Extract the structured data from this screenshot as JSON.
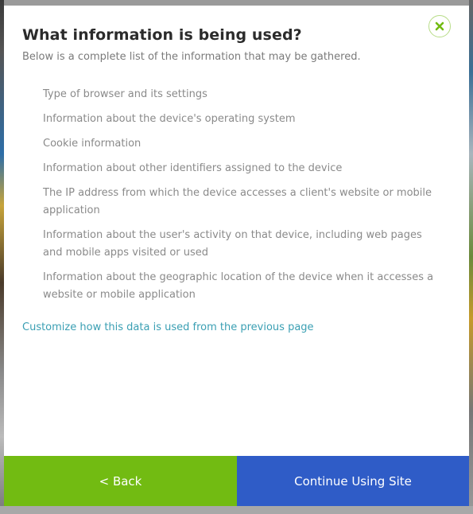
{
  "modal": {
    "title": "What information is being used?",
    "subtitle": "Below is a complete list of the information that may be gathered.",
    "close_icon": "close-icon",
    "items": [
      "Type of browser and its settings",
      "Information about the device's operating system",
      "Cookie information",
      "Information about other identifiers assigned to the device",
      "The IP address from which the device accesses a client's website or mobile application",
      "Information about the user's activity on that device, including web pages and mobile apps visited or used",
      "Information about the geographic location of the device when it accesses a website or mobile application"
    ],
    "customize_link": "Customize how this data is used from the previous page"
  },
  "footer": {
    "back_label": "< Back",
    "continue_label": "Continue Using Site"
  },
  "colors": {
    "accent_green": "#72bb12",
    "accent_blue": "#2f5cc7",
    "link": "#3a9fb3",
    "close_icon": "#72bb12"
  }
}
